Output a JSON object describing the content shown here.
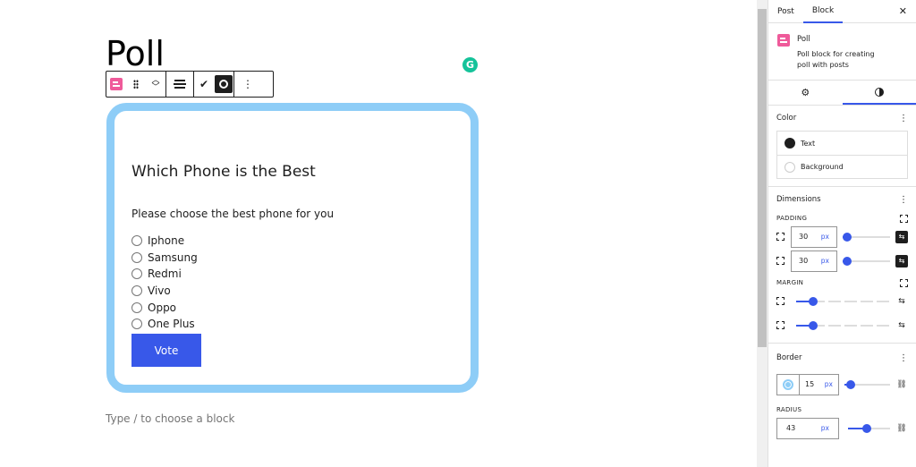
{
  "editor": {
    "title": "Poll",
    "placeholder": "Type / to choose a block",
    "grammarly_letter": "G"
  },
  "poll": {
    "question": "Which Phone is the Best",
    "description": "Please choose the best phone for you",
    "options": [
      "Iphone",
      "Samsung",
      "Redmi",
      "Vivo",
      "Oppo",
      "One Plus"
    ],
    "vote_label": "Vote",
    "border_color": "#8ecdf7",
    "button_color": "#3858e9"
  },
  "sidebar": {
    "tabs": [
      "Post",
      "Block"
    ],
    "active_tab": "Block",
    "close": "✕",
    "block": {
      "name": "Poll",
      "description": "Poll block for creating poll with posts"
    },
    "color": {
      "title": "Color",
      "items": [
        "Text",
        "Background"
      ]
    },
    "dimensions": {
      "title": "Dimensions",
      "padding_label": "PADDING",
      "padding_values": [
        "30",
        "30"
      ],
      "unit": "px",
      "margin_label": "MARGIN"
    },
    "border": {
      "title": "Border",
      "width": "15",
      "unit": "px",
      "radius_label": "RADIUS",
      "radius": "43"
    }
  }
}
